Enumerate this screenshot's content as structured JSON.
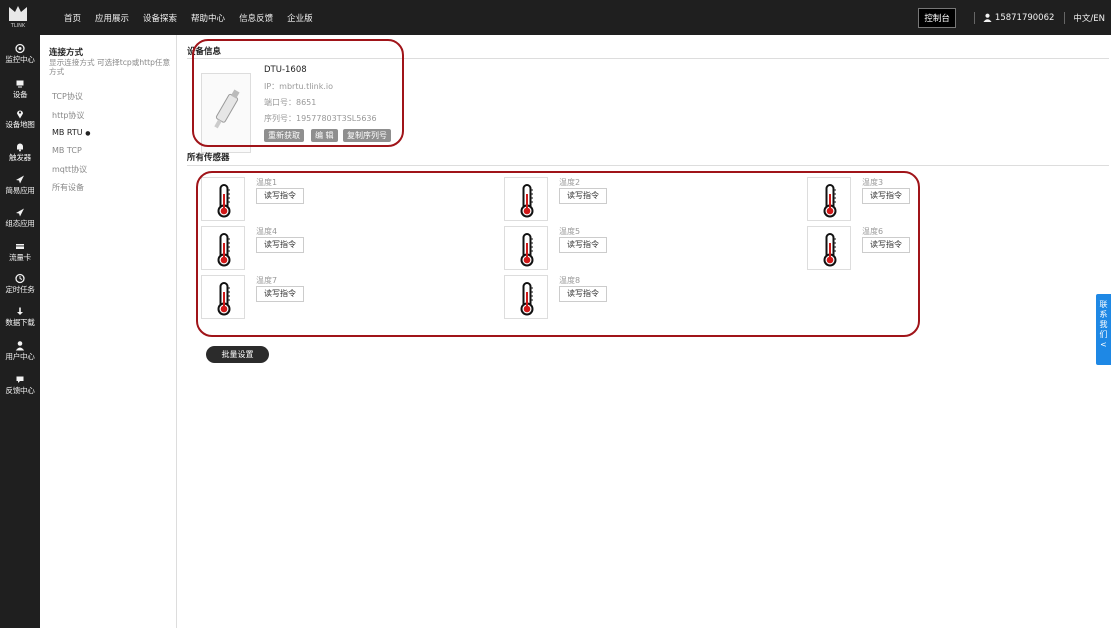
{
  "topnav": {
    "logo_text": "TLINK",
    "items": [
      "首页",
      "应用展示",
      "设备探索",
      "帮助中心",
      "信息反馈",
      "企业版"
    ],
    "console": "控制台",
    "user": "15871790062",
    "lang": "中文/EN"
  },
  "sidebar": {
    "items": [
      {
        "label": "监控中心",
        "icon": "target-icon"
      },
      {
        "label": "设备",
        "icon": "monitor-icon"
      },
      {
        "label": "设备地图",
        "icon": "map-pin-icon"
      },
      {
        "label": "触发器",
        "icon": "bell-icon"
      },
      {
        "label": "简易应用",
        "icon": "send-icon"
      },
      {
        "label": "组态应用",
        "icon": "send-icon"
      },
      {
        "label": "流量卡",
        "icon": "card-icon"
      },
      {
        "label": "定时任务",
        "icon": "clock-icon"
      },
      {
        "label": "数据下载",
        "icon": "download-icon"
      },
      {
        "label": "用户中心",
        "icon": "user-icon"
      },
      {
        "label": "反馈中心",
        "icon": "chat-icon"
      }
    ]
  },
  "subnav": {
    "title": "连接方式",
    "desc": "显示连接方式 可选择tcp或http任意方式",
    "items": [
      "TCP协议",
      "http协议",
      "MB RTU",
      "MB TCP",
      "mqtt协议",
      "所有设备"
    ],
    "active_index": 2,
    "active_mark": "●"
  },
  "device": {
    "section_title": "设备信息",
    "name": "DTU-1608",
    "ip": "IP：mbrtu.tlink.io",
    "port": "端口号：8651",
    "serial": "序列号：19577803T3SL5636",
    "buttons": [
      "重新获取",
      "编 辑",
      "复制序列号"
    ]
  },
  "sensors": {
    "section_title": "所有传感器",
    "cmd_label": "读写指令",
    "items": [
      "温度1",
      "温度2",
      "温度3",
      "温度4",
      "温度5",
      "温度6",
      "温度7",
      "温度8"
    ]
  },
  "batch_label": "批量设置",
  "contact": [
    "联",
    "系",
    "我",
    "们",
    "<"
  ],
  "colors": {
    "highlight": "#a01419",
    "contact": "#1e88e5",
    "dark": "#1f1f1f"
  }
}
